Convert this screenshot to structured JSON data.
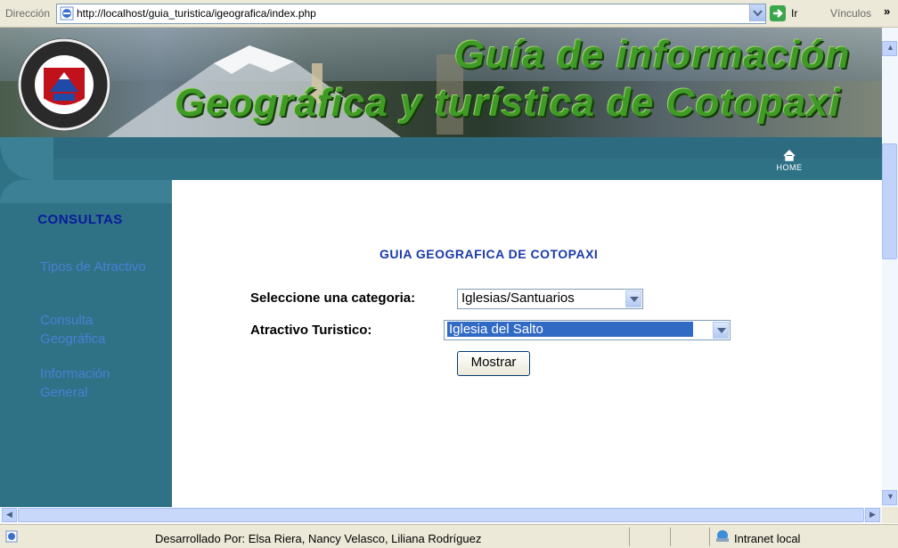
{
  "address_bar": {
    "label": "Dirección",
    "url": "http://localhost/guia_turistica/igeografica/index.php",
    "go_label": "Ir",
    "links_label": "Vínculos",
    "overflow": "»"
  },
  "banner": {
    "title_line1": "Guía de información",
    "title_line2": "Geográfica y turística de Cotopaxi",
    "title_color": "#3f9b25"
  },
  "nav": {
    "home_label": "HOME"
  },
  "sidebar": {
    "heading": "CONSULTAS",
    "items": [
      {
        "label": "Tipos de Atractivo"
      },
      {
        "label": "Consulta Geográfica"
      },
      {
        "label": "Información General"
      }
    ]
  },
  "main": {
    "heading": "GUIA GEOGRAFICA DE COTOPAXI",
    "category_label": "Seleccione una categoria:",
    "category_value": "Iglesias/Santuarios",
    "attraction_label": "Atractivo Turistico:",
    "attraction_value": "Iglesia del Salto",
    "submit_label": "Mostrar"
  },
  "status_bar": {
    "text": "Desarrollado Por: Elsa Riera, Nancy Velasco, Liliana Rodríguez",
    "zone": "Intranet local"
  },
  "colors": {
    "teal": "#2f7286",
    "heading_blue": "#1a3aa8",
    "sidebar_link": "#4a7fd4",
    "selection": "#316ac5"
  }
}
